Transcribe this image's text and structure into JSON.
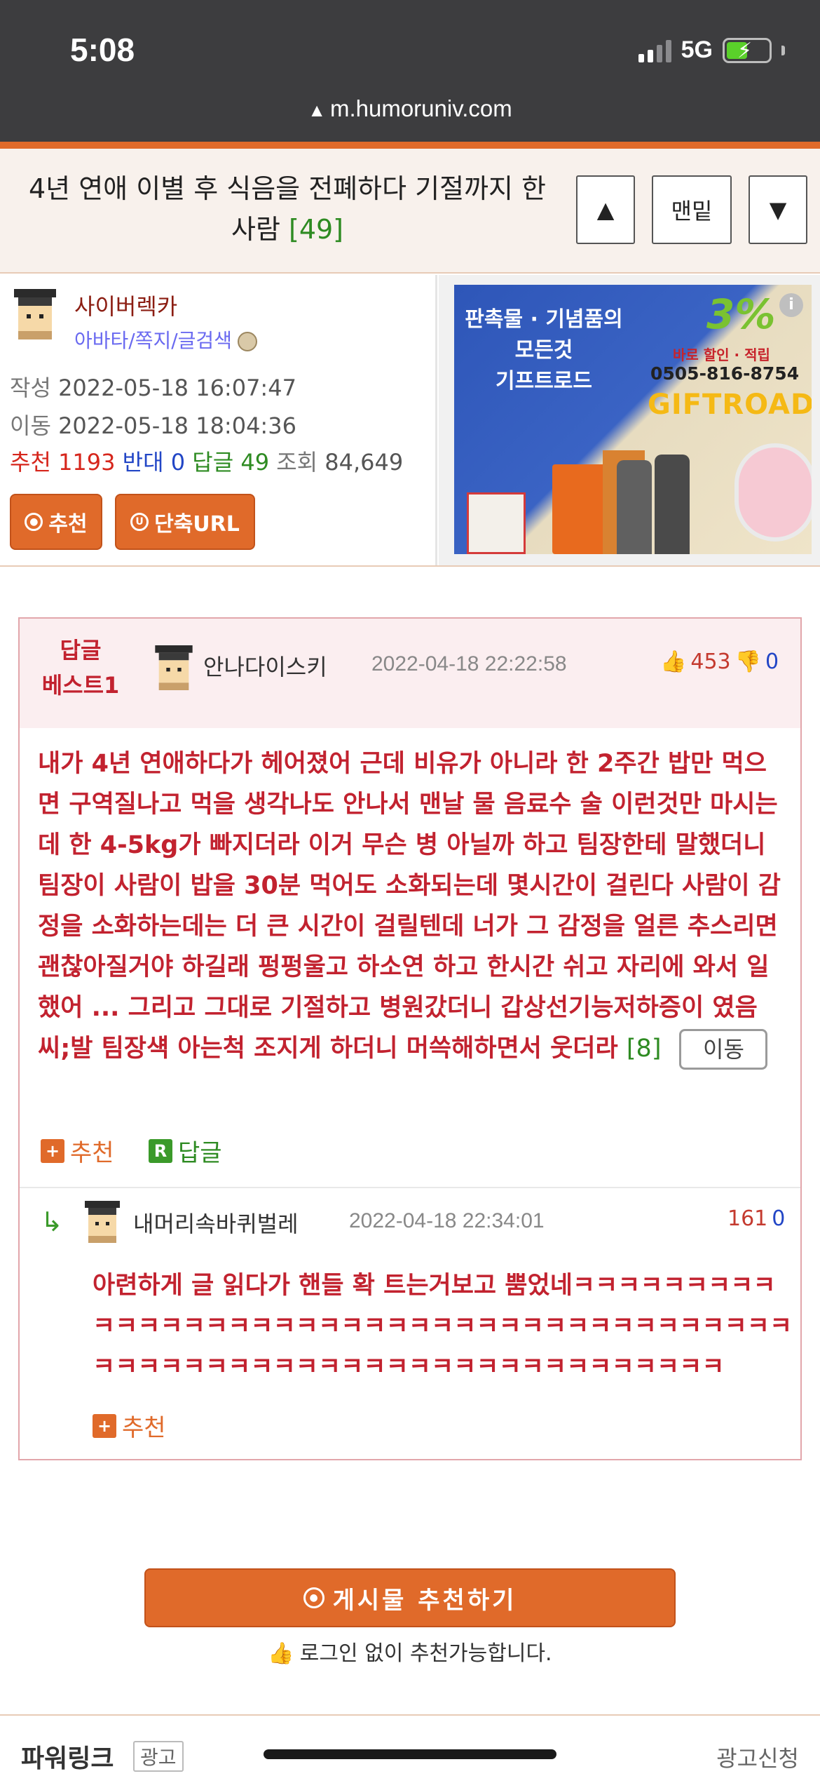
{
  "status": {
    "time": "5:08",
    "network": "5G",
    "url": "m.humoruniv.com"
  },
  "title": {
    "text": "4년 연애 이별 후 식음을 전폐하다 기절까지 한 사람",
    "count": "[49]"
  },
  "nav": {
    "up": "▲",
    "bottom": "맨밑",
    "down": "▼"
  },
  "author": {
    "name": "사이버렉카",
    "links": "아바타/쪽지/글검색"
  },
  "meta": {
    "written_label": "작성",
    "written": "2022-05-18 16:07:47",
    "moved_label": "이동",
    "moved": "2022-05-18 18:04:36"
  },
  "stats": {
    "rec_label": "추천",
    "rec": "1193",
    "opp_label": "반대",
    "opp": "0",
    "rep_label": "답글",
    "rep": "49",
    "view_label": "조회",
    "view": "84,649"
  },
  "buttons": {
    "recommend": "추천",
    "short_url": "단축URL"
  },
  "ad": {
    "line1": "판촉물 · 기념품의",
    "line2": "모든것",
    "line3": "기프트로드",
    "pct": "3%",
    "sub": "바로 할인 · 적립",
    "phone": "0505-816-8754",
    "brand": "GIFTROAD",
    "info": "i"
  },
  "best": {
    "label1": "답글",
    "label2": "베스트1",
    "name": "안나다이스키",
    "date": "2022-04-18 22:22:58",
    "up": "453",
    "down": "0",
    "body": "내가 4년 연애하다가 헤어졌어 근데 비유가 아니라 한 2주간 밥만 먹으면 구역질나고 먹을 생각나도 안나서 맨날 물 음료수 술 이런것만 마시는데 한 4-5kg가 빠지더라 이거 무슨 병 아닐까 하고 팀장한테 말했더니 팀장이 사람이 밥을 30분 먹어도 소화되는데 몇시간이 걸린다 사람이 감정을 소화하는데는 더 큰 시간이 걸릴텐데 너가 그 감정을 얼른 추스리면 괜찮아질거야 하길래 펑펑울고 하소연 하고 한시간 쉬고 자리에 와서 일했어 ... 그리고 그대로 기절하고 병원갔더니 갑상선기능저하증이 였음 씨;발 팀장섁 아는척 조지게 하더니 머쓱해하면서 웃더라",
    "reply_count": "[8]",
    "move": "이동",
    "act_rec": "추천",
    "act_rep": "답글"
  },
  "reply": {
    "name": "내머리속바퀴벌레",
    "date": "2022-04-18 22:34:01",
    "up": "161",
    "down": "0",
    "body": "아련하게 글 읽다가 핸들 확 트는거보고 뿜었네ㅋㅋㅋㅋㅋㅋㅋㅋㅋㅋㅋㅋㅋㅋㅋㅋㅋㅋㅋㅋㅋㅋㅋㅋㅋㅋㅋㅋㅋㅋㅋㅋㅋㅋㅋㅋㅋㅋㅋㅋㅋㅋㅋㅋㅋㅋㅋㅋㅋㅋㅋㅋㅋㅋㅋㅋㅋㅋㅋㅋㅋㅋㅋㅋㅋㅋㅋㅋ",
    "act_rec": "추천"
  },
  "recommend_big": {
    "label": "게시물 추천하기",
    "note": "로그인 없이 추천가능합니다."
  },
  "footer": {
    "powerlink": "파워링크",
    "ad_tag": "광고",
    "ad_request": "광고신청"
  },
  "colors": {
    "accent": "#e06a2a",
    "best_text": "#c2222f",
    "green": "#2e8b22",
    "blue": "#2246c6"
  }
}
